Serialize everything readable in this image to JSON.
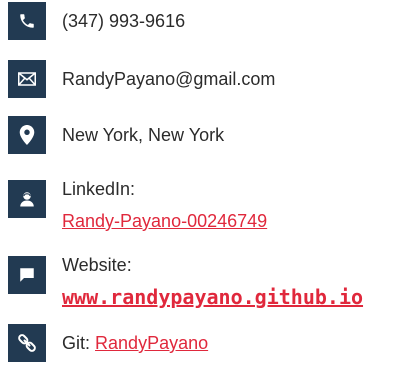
{
  "contact": {
    "phone": "(347) 993-9616",
    "email": "RandyPayano@gmail.com",
    "location": "New York, New York",
    "linkedin_label": "LinkedIn:",
    "linkedin_link": "Randy-Payano-00246749",
    "website_label": "Website:",
    "website_link": "www.randypayano.github.io",
    "git_label": "Git:",
    "git_link": "RandyPayano"
  },
  "icons": {
    "phone": "phone-icon",
    "email": "envelope-icon",
    "location": "map-pin-icon",
    "linkedin": "person-icon",
    "website": "chat-bubble-icon",
    "git": "chain-link-icon"
  },
  "colors": {
    "icon_bg": "#223a52",
    "link": "#e0283c",
    "text": "#2b2b2b"
  }
}
